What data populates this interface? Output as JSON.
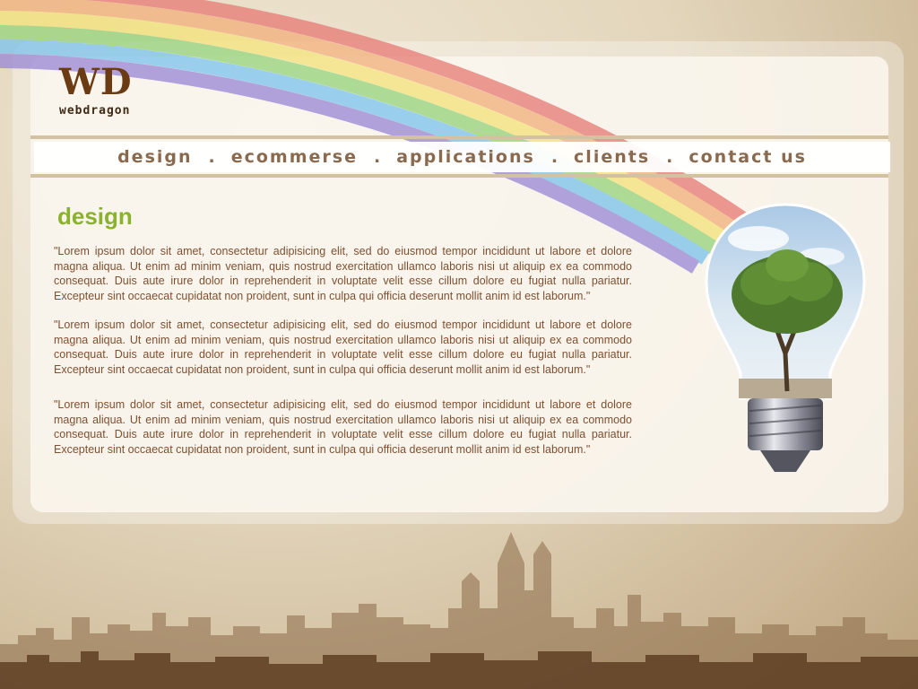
{
  "logo": {
    "mark": "WD",
    "name": "webdragon"
  },
  "nav": {
    "items": [
      "design",
      "ecommerse",
      "applications",
      "clients",
      "contact us"
    ],
    "separator": "."
  },
  "main": {
    "heading": "design",
    "paragraphs": [
      "\"Lorem ipsum dolor sit amet, consectetur adipisicing elit, sed do eiusmod tempor incididunt ut labore et dolore magna aliqua. Ut enim ad minim veniam, quis nostrud exercitation ullamco laboris nisi ut aliquip ex ea commodo consequat. Duis aute irure dolor in reprehenderit in voluptate velit esse cillum dolore eu fugiat nulla pariatur. Excepteur sint occaecat cupidatat non proident, sunt in culpa qui officia deserunt mollit anim id est laborum.\"",
      "\"Lorem ipsum dolor sit amet, consectetur adipisicing elit, sed do eiusmod tempor incididunt ut labore et dolore magna aliqua. Ut enim ad minim veniam, quis nostrud exercitation ullamco laboris nisi ut aliquip ex ea commodo consequat. Duis aute irure dolor in reprehenderit in voluptate velit esse cillum dolore eu fugiat nulla pariatur. Excepteur sint occaecat cupidatat non proident, sunt in culpa qui officia deserunt mollit anim id est laborum.\"",
      "\"Lorem ipsum dolor sit amet, consectetur adipisicing elit, sed do eiusmod tempor incididunt ut labore et dolore magna aliqua. Ut enim ad minim veniam, quis nostrud exercitation ullamco laboris nisi ut aliquip ex ea commodo consequat. Duis aute irure dolor in reprehenderit in voluptate velit esse cillum dolore eu fugiat nulla pariatur. Excepteur sint occaecat cupidatat non proident, sunt in culpa qui officia deserunt mollit anim id est laborum.\""
    ]
  },
  "colors": {
    "heading": "#8ab22e",
    "body_text": "#7e5030",
    "nav_text": "#8a6a4f",
    "logo": "#6b3c14",
    "rainbow": [
      "#e87e78",
      "#f2b27e",
      "#f4e37e",
      "#98d47e",
      "#7fc4ec",
      "#9c8ad6"
    ]
  },
  "illustrations": [
    "rainbow-graphic",
    "lightbulb-tree-icon",
    "city-skyline"
  ]
}
